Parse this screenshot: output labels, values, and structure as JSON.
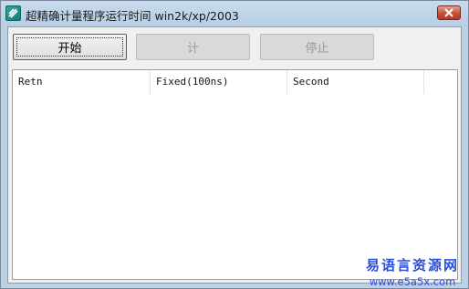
{
  "window": {
    "title": "超精确计量程序运行时间 win2k/xp/2003"
  },
  "icons": {
    "app": "app-icon",
    "close": "close-icon"
  },
  "buttons": {
    "start": "开始",
    "count": "计",
    "stop": "停止"
  },
  "list": {
    "columns": [
      "Retn",
      "Fixed(100ns)",
      "Second"
    ]
  },
  "watermark": {
    "line1": "易语言资源网",
    "line2": "www.e5a5x.com"
  },
  "colors": {
    "titlebar": "#bcd0e6",
    "close_button": "#c7503a",
    "watermark": "#2a4fd6"
  }
}
